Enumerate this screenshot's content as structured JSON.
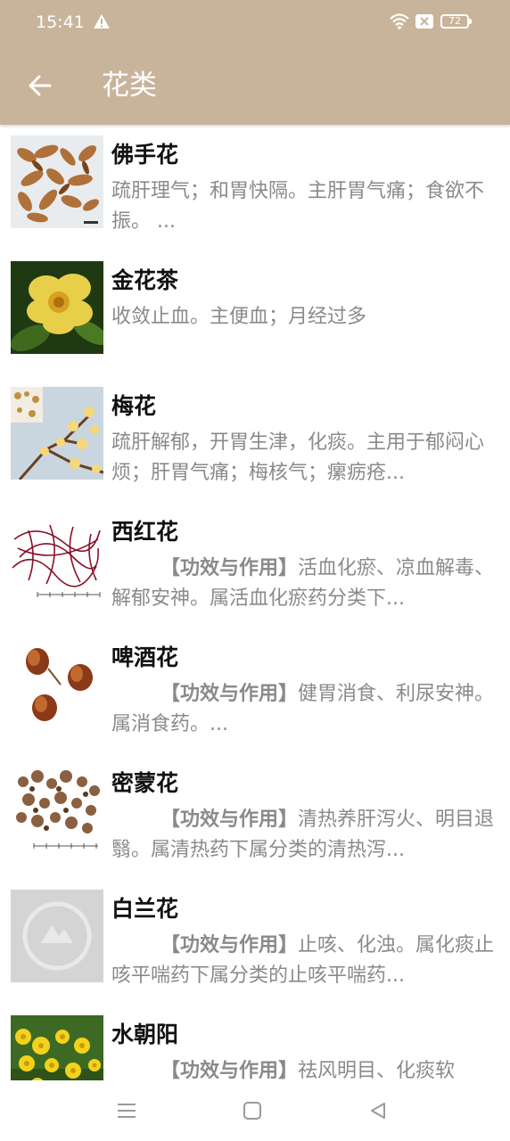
{
  "status": {
    "time": "15:41",
    "battery": "72",
    "icons": [
      "warning-icon",
      "wifi-icon",
      "x-box-icon",
      "battery-icon"
    ]
  },
  "appbar": {
    "title": "花类",
    "back_icon": "arrow-left-icon",
    "color": "#c8b49b"
  },
  "items": [
    {
      "name": "佛手花",
      "header": "",
      "desc": "疏肝理气；和胃快隔。主肝胃气痛；食欲不振。 ..."
    },
    {
      "name": "金花茶",
      "header": "",
      "desc": "收敛止血。主便血；月经过多"
    },
    {
      "name": "梅花",
      "header": "",
      "desc": "疏肝解郁，开胃生津，化痰。主用于郁闷心烦；肝胃气痛；梅核气；瘰疬疮..."
    },
    {
      "name": "西红花",
      "header": "【功效与作用】",
      "desc": "活血化瘀、凉血解毒、解郁安神。属活血化瘀药分类下..."
    },
    {
      "name": "啤酒花",
      "header": "【功效与作用】",
      "desc": "健胃消食、利尿安神。属消食药。..."
    },
    {
      "name": "密蒙花",
      "header": "【功效与作用】",
      "desc": "清热养肝泻火、明目退翳。属清热药下属分类的清热泻..."
    },
    {
      "name": "白兰花",
      "header": "【功效与作用】",
      "desc": "止咳、化浊。属化痰止咳平喘药下属分类的止咳平喘药..."
    },
    {
      "name": "水朝阳",
      "header": "【功效与作用】",
      "desc": "祛风明目、化痰软"
    }
  ],
  "navbar": {
    "icons": [
      "menu-icon",
      "home-square-icon",
      "back-triangle-icon"
    ]
  }
}
